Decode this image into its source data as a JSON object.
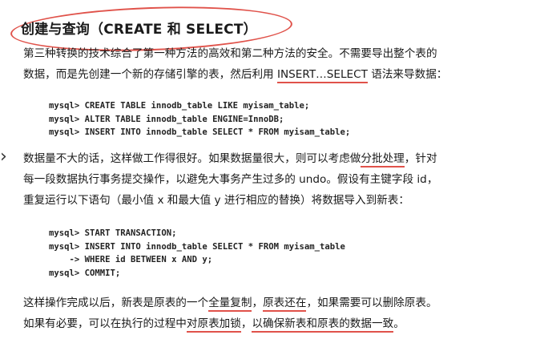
{
  "heading": "创建与查询（CREATE 和 SELECT）",
  "para1": {
    "line1": "第三种转换的技术综合了第一种方法的高效和第二种方法的安全。不需要导出整个表的",
    "line2_pre": "数据，而是先创建一个新的存储引擎的表，然后利用 ",
    "line2_mark": "INSERT…SELECT",
    "line2_post": " 语法来导数据："
  },
  "code1": "mysql> CREATE TABLE innodb_table LIKE myisam_table;\nmysql> ALTER TABLE innodb_table ENGINE=InnoDB;\nmysql> INSERT INTO innodb_table SELECT * FROM myisam_table;",
  "para2": {
    "line1_pre": "数据量不大的话，这样做工作得很好。如果数据量很大，则可以考虑做",
    "line1_mark": "分批处理",
    "line1_post": "，针对",
    "line2": "每一段数据执行事务提交操作，以避免大事务产生过多的 undo。假设有主键字段 id，",
    "line3": "重复运行以下语句（最小值 x 和最大值 y 进行相应的替换）将数据导入到新表："
  },
  "code2": "mysql> START TRANSACTION;\nmysql> INSERT INTO innodb_table SELECT * FROM myisam_table\n    -> WHERE id BETWEEN x AND y;\nmysql> COMMIT;",
  "para3": {
    "line1_pre": "这样操作完成以后，新表是原表的一个",
    "line1_mark1": "全量复制",
    "line1_mid": "，",
    "line1_mark2": "原表还在",
    "line1_post": "，如果需要可以删除原表。",
    "line2_pre": "如果有必要，可以在执行的过程中",
    "line2_mark1": "对原表加锁",
    "line2_mid": "，",
    "line2_mark2": "以确保新表和原表的数据一致",
    "line2_post": "。"
  },
  "annotation_color": "#e0524a"
}
